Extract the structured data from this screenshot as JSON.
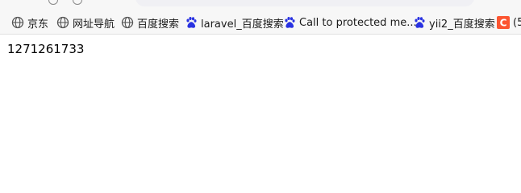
{
  "bookmarks": [
    {
      "label": "京东",
      "icon": "globe-icon"
    },
    {
      "label": "网址导航",
      "icon": "globe-icon"
    },
    {
      "label": "百度搜索",
      "icon": "globe-icon"
    },
    {
      "label": "laravel_百度搜索",
      "icon": "baidu-paw-icon"
    },
    {
      "label": "Call to protected me...",
      "icon": "baidu-paw-icon"
    },
    {
      "label": "yii2_百度搜索",
      "icon": "baidu-paw-icon"
    },
    {
      "label": "(5",
      "icon": "csdn-c-icon"
    }
  ],
  "page": {
    "output": "1271261733"
  },
  "colors": {
    "toolbar_bg": "#f7f7f7",
    "baidu_blue": "#2932e1",
    "csdn_orange": "#fc5531",
    "text": "#1a1a1a"
  }
}
